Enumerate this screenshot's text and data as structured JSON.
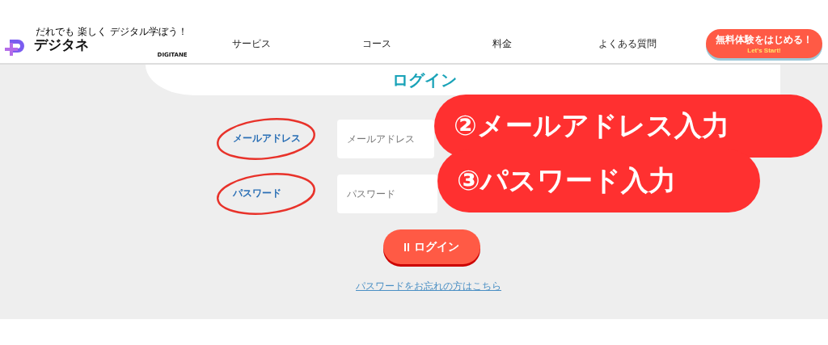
{
  "header": {
    "logo": {
      "tagline": "だれでも 楽しく デジタル学ぼう！",
      "name": "デジタネ",
      "sub": "DIGITANE"
    },
    "nav": [
      "サービス",
      "コース",
      "料金",
      "よくある質問"
    ],
    "cta": {
      "label": "無料体験をはじめる！",
      "sub": "Let's Start!"
    }
  },
  "login": {
    "title": "ログイン",
    "fields": [
      {
        "label": "メールアドレス",
        "placeholder": "メールアドレス",
        "annotation": "②メールアドレス入力"
      },
      {
        "label": "パスワード",
        "placeholder": "パスワード",
        "annotation": "③パスワード入力"
      }
    ],
    "submit": "ログイン",
    "forgot": "パスワードをお忘れの方はこちら"
  }
}
